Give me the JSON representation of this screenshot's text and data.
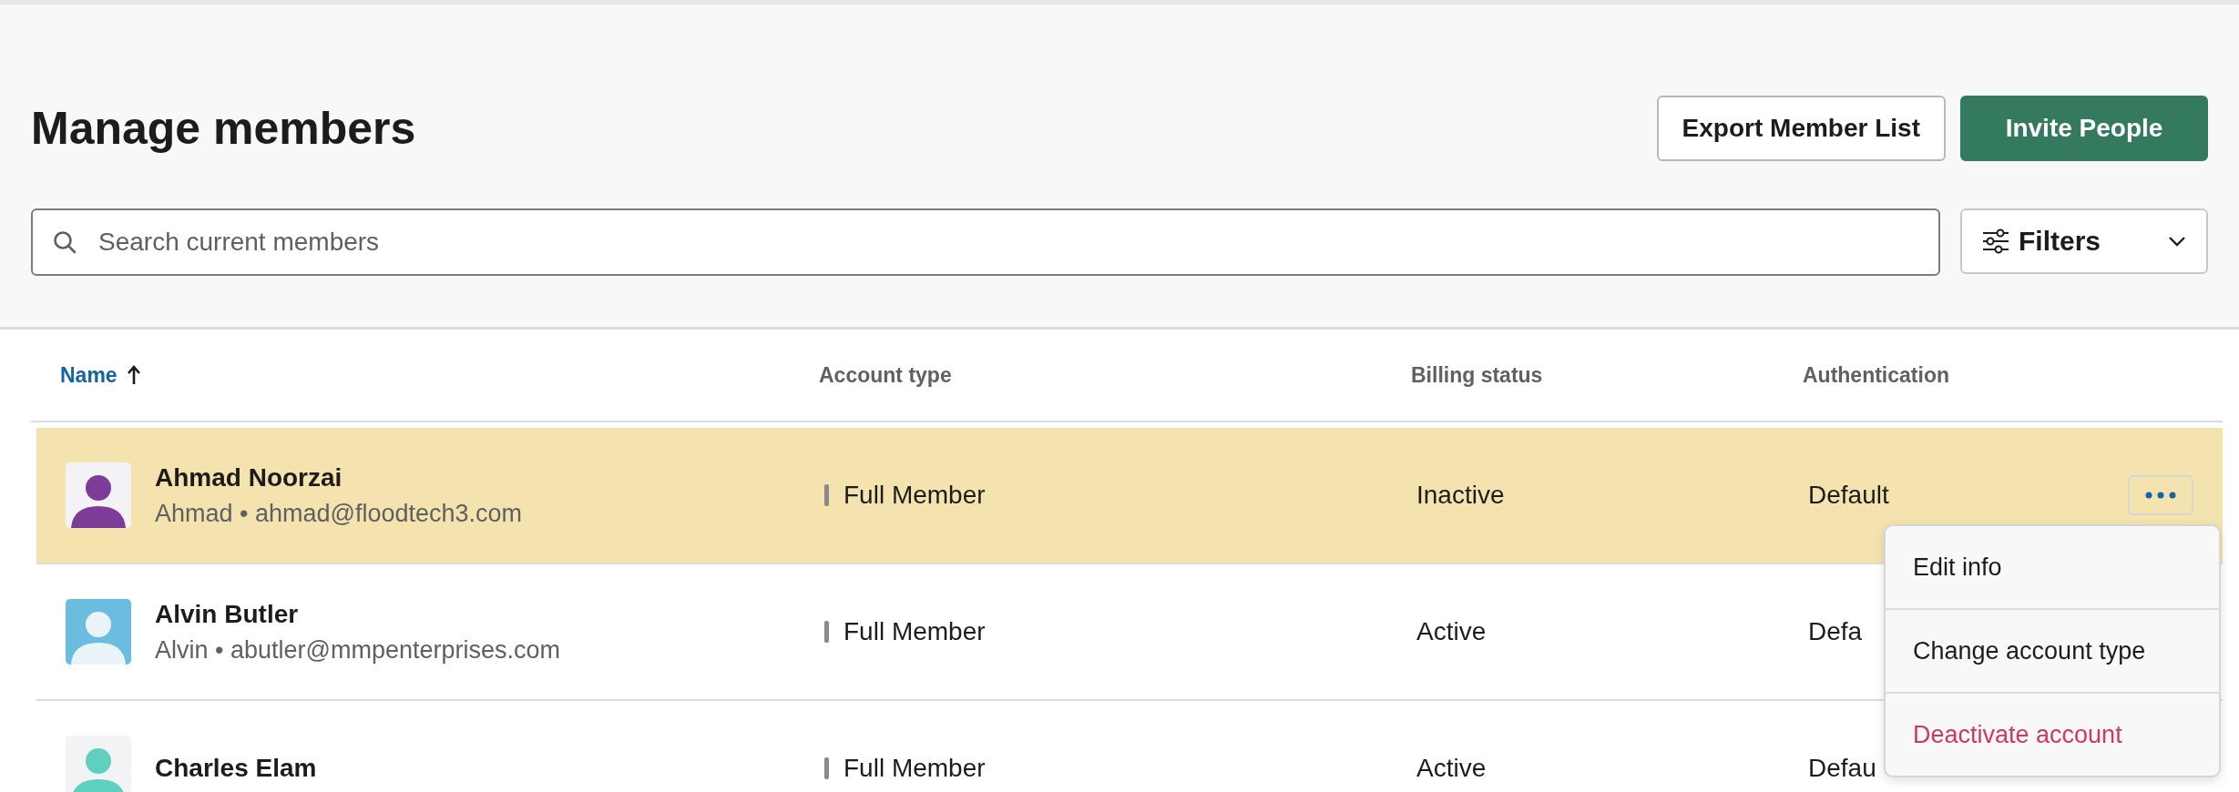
{
  "page": {
    "title": "Manage members"
  },
  "header_buttons": [
    {
      "label": "Export Member List",
      "kind": "secondary"
    },
    {
      "label": "Invite People",
      "kind": "primary"
    }
  ],
  "search": {
    "placeholder": "Search current members"
  },
  "filters": {
    "label": "Filters"
  },
  "table": {
    "columns": [
      {
        "label": "Name",
        "sorted": true
      },
      {
        "label": "Account type",
        "sorted": false
      },
      {
        "label": "Billing status",
        "sorted": false
      },
      {
        "label": "Authentication",
        "sorted": false
      }
    ],
    "rows": [
      {
        "name": "Ahmad Noorzai",
        "detail": "Ahmad • ahmad@floodtech3.com",
        "account_type": "Full Member",
        "billing_status": "Inactive",
        "authentication": "Default",
        "selected": true,
        "kind": "outline",
        "color": "#7d3c98"
      },
      {
        "name": "Alvin Butler",
        "detail": "Alvin • abutler@mmpenterprises.com",
        "account_type": "Full Member",
        "billing_status": "Active",
        "authentication": "Defa",
        "selected": false,
        "kind": "filled",
        "color": "#6bbde0"
      },
      {
        "name": "Charles Elam",
        "account_type": "Full Member",
        "billing_status": "Active",
        "authentication": "Defau",
        "selected": false,
        "kind": "outline",
        "color": "#5fd0c0"
      }
    ]
  },
  "row_menu": {
    "items": [
      {
        "label": "Edit info",
        "kind": "normal"
      },
      {
        "label": "Change account type",
        "kind": "normal"
      },
      {
        "label": "Deactivate account",
        "kind": "danger"
      }
    ]
  }
}
